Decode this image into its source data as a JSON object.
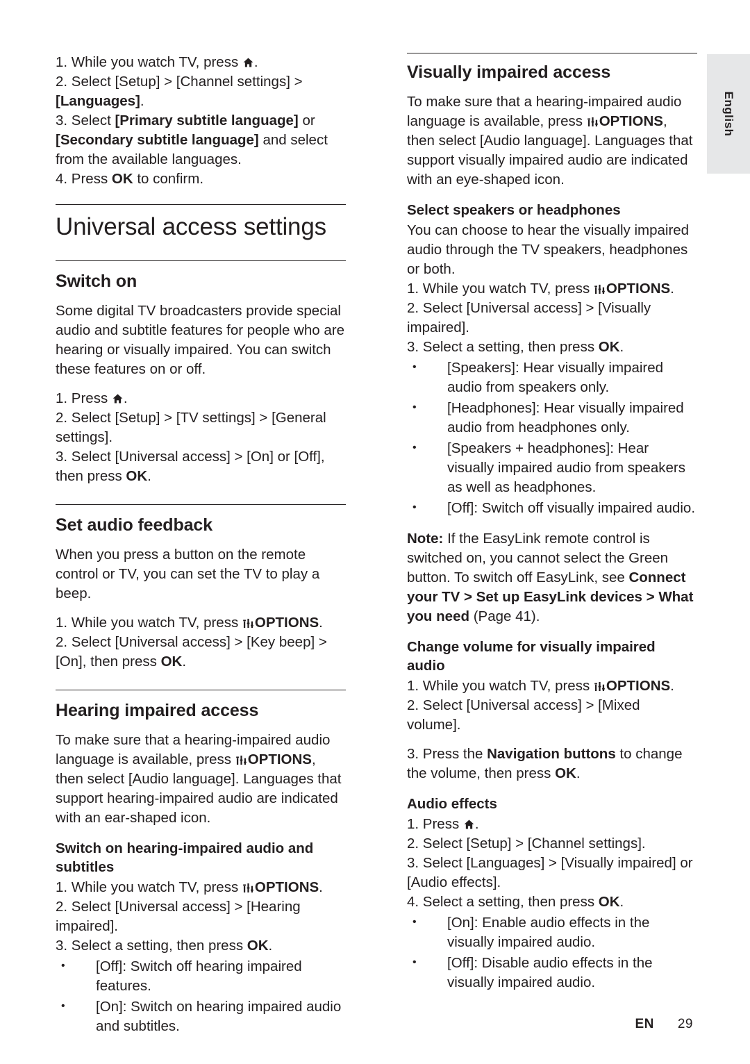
{
  "sidebar": {
    "language_tab": "English"
  },
  "footer": {
    "region": "EN",
    "page_number": "29"
  },
  "left_column": {
    "intro_steps": {
      "s1_a": "1. While you watch TV, press ",
      "s1_b": ".",
      "s2_a": "2. Select [Setup] > [Channel settings] > ",
      "s2_b": "[Languages]",
      "s2_c": ".",
      "s3_a": "3. Select ",
      "s3_b": "[Primary subtitle language]",
      "s3_c": " or ",
      "s3_d": "[Secondary subtitle language]",
      "s3_e": " and select from the available languages.",
      "s4_a": "4. Press ",
      "s4_b": "OK",
      "s4_c": " to confirm."
    },
    "chapter_title": "Universal access settings",
    "switch_on": {
      "heading": "Switch on",
      "body": "Some digital TV broadcasters provide special audio and subtitle features for people who are hearing or visually impaired. You can switch these features on or off.",
      "s1_a": "1. Press ",
      "s1_b": ".",
      "s2": "2. Select [Setup] > [TV settings] > [General settings].",
      "s3_a": "3. Select [Universal access] > [On] or [Off], then press ",
      "s3_b": "OK",
      "s3_c": "."
    },
    "audio_feedback": {
      "heading": "Set audio feedback",
      "body": "When you press a button on the remote control or TV, you can set the TV to play a beep.",
      "s1_a": "1. While you watch TV, press ",
      "s1_b": "OPTIONS",
      "s1_c": ".",
      "s2_a": "2. Select [Universal access] > [Key beep] > [On], then press ",
      "s2_b": "OK",
      "s2_c": "."
    },
    "hearing_impaired": {
      "heading": "Hearing impaired access",
      "body_a": "To make sure that a hearing-impaired audio language is available, press ",
      "body_b": "OPTIONS",
      "body_c": ", then select [Audio language]. Languages that support hearing-impaired audio are indicated with an ear-shaped icon.",
      "sub_heading": "Switch on hearing-impaired audio and subtitles",
      "s1_a": "1. While you watch TV, press ",
      "s1_b": "OPTIONS",
      "s1_c": ".",
      "s2": "2. Select [Universal access] > [Hearing impaired].",
      "s3_a": "3. Select a setting, then press ",
      "s3_b": "OK",
      "s3_c": ".",
      "bullets": [
        "[Off]: Switch off hearing impaired features.",
        "[On]: Switch on hearing impaired audio and subtitles."
      ]
    }
  },
  "right_column": {
    "visually_impaired": {
      "heading": "Visually impaired access",
      "body_a": "To make sure that a hearing-impaired audio language is available, press ",
      "body_b": "OPTIONS",
      "body_c": ", then select [Audio language]. Languages that support visually impaired audio are indicated with an eye-shaped icon.",
      "speakers_heading": "Select speakers or headphones",
      "speakers_body": "You can choose to hear the visually impaired audio through the TV speakers, headphones or both.",
      "s1_a": "1. While you watch TV, press ",
      "s1_b": "OPTIONS",
      "s1_c": ".",
      "s2": "2. Select [Universal access] > [Visually impaired].",
      "s3_a": "3. Select a setting, then press ",
      "s3_b": "OK",
      "s3_c": ".",
      "bullets": [
        "[Speakers]: Hear visually impaired audio from speakers only.",
        "[Headphones]: Hear visually impaired audio from headphones only.",
        "[Speakers + headphones]: Hear visually impaired audio from speakers as well as headphones.",
        "[Off]: Switch off visually impaired audio."
      ],
      "note_a": "Note: ",
      "note_b": "If the EasyLink remote control is switched on, you cannot select the Green button. To switch off EasyLink, see ",
      "note_c": "Connect your TV > Set up EasyLink devices > What you need",
      "note_d": " (Page 41).",
      "volume_heading": "Change volume for visually impaired audio",
      "v1_a": "1. While you watch TV, press ",
      "v1_b": "OPTIONS",
      "v1_c": ".",
      "v2": "2. Select [Universal access] > [Mixed volume].",
      "v3_a": "3. Press the ",
      "v3_b": "Navigation buttons",
      "v3_c": " to change the volume, then press ",
      "v3_d": "OK",
      "v3_e": "."
    },
    "audio_effects": {
      "heading": "Audio effects",
      "s1_a": "1. Press ",
      "s1_b": ".",
      "s2": "2. Select [Setup] > [Channel settings].",
      "s3": "3. Select [Languages] > [Visually impaired] or [Audio effects].",
      "s4_a": "4. Select a setting, then press ",
      "s4_b": "OK",
      "s4_c": ".",
      "bullets": [
        "[On]: Enable audio effects in the visually impaired audio.",
        "[Off]: Disable audio effects in the visually impaired audio."
      ]
    }
  }
}
